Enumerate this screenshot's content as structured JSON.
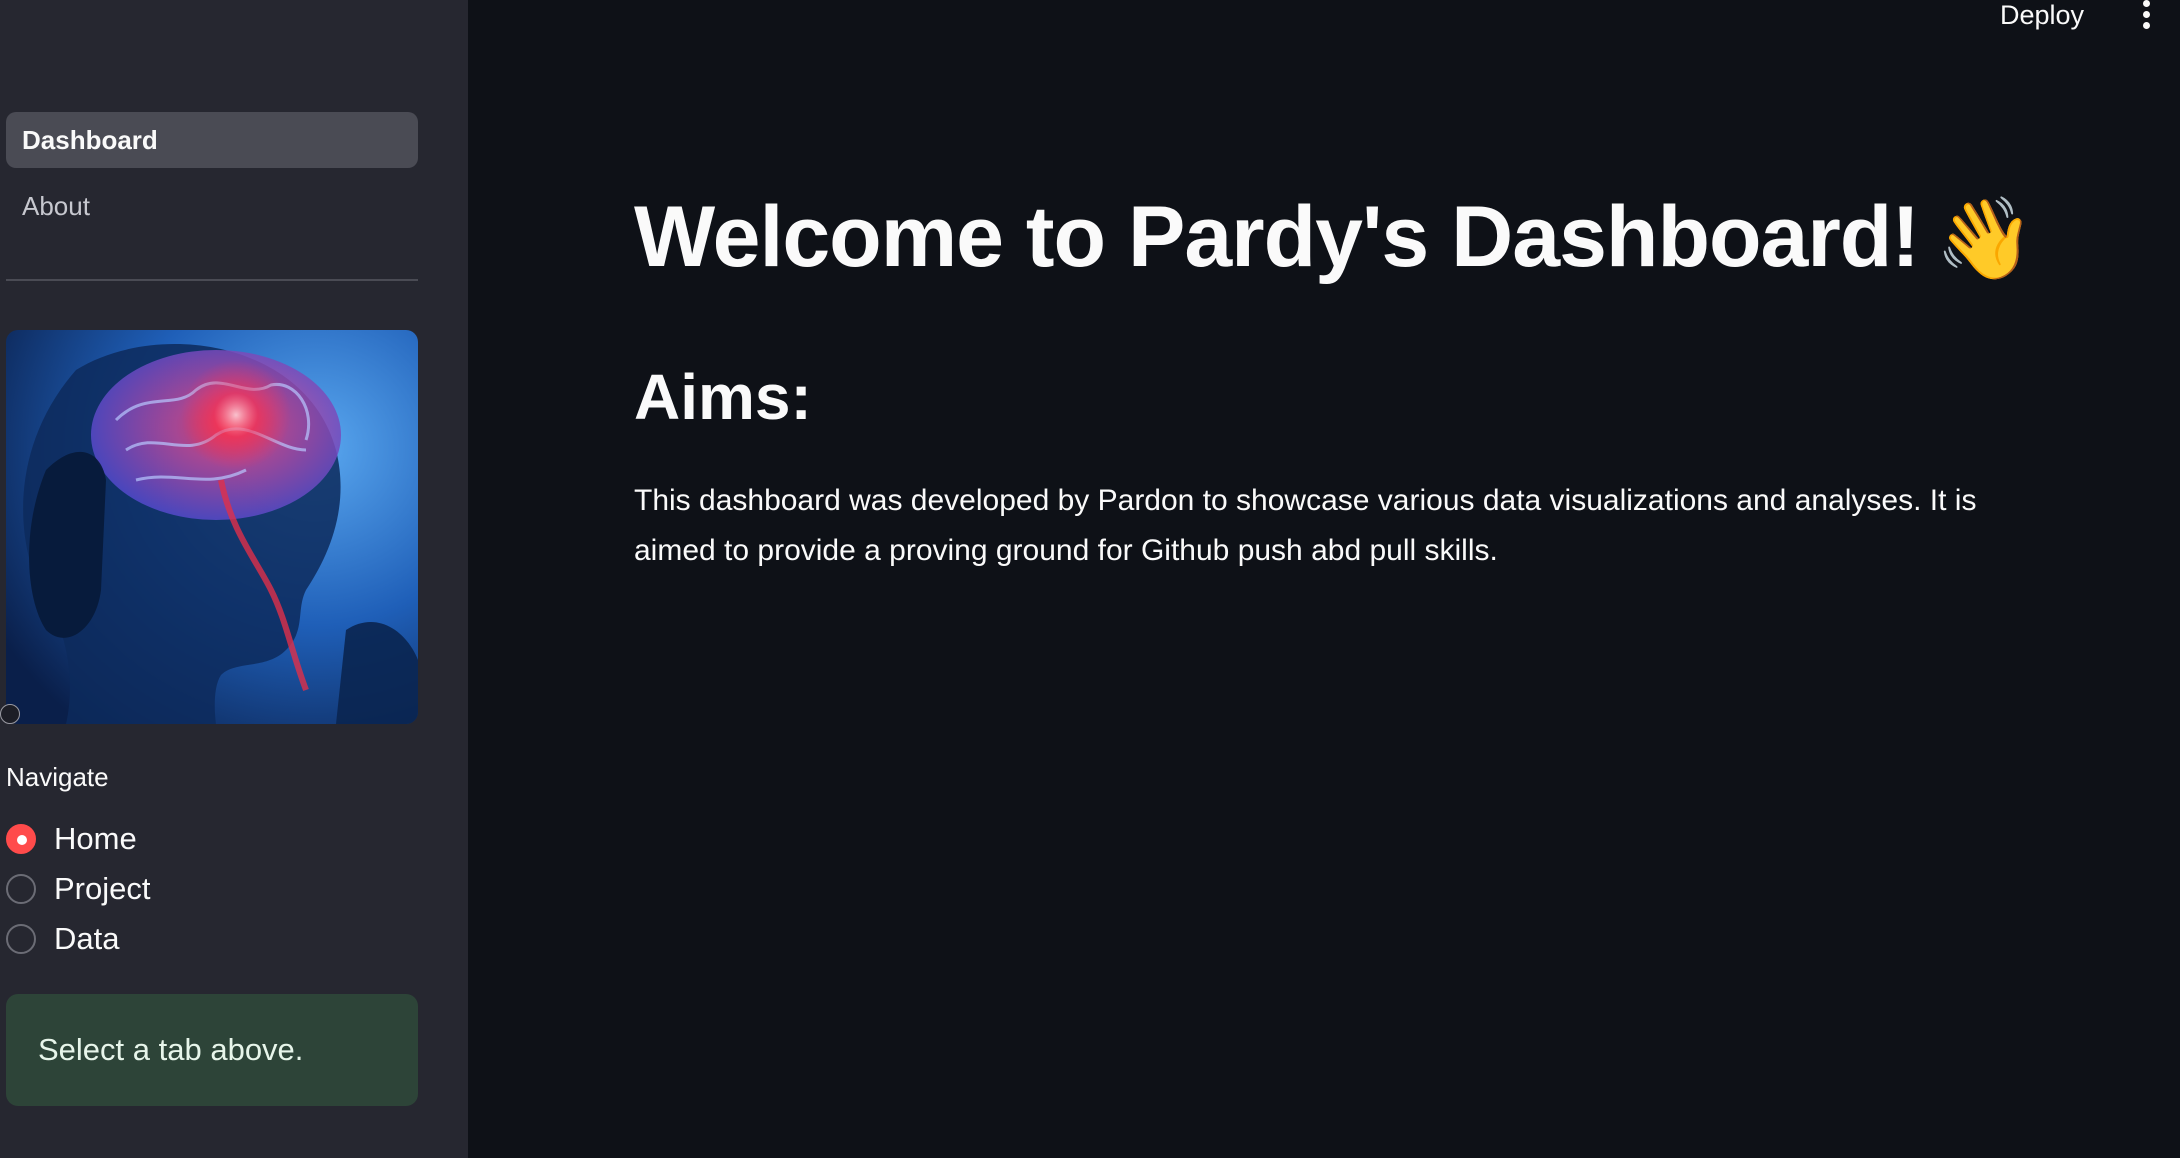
{
  "sidebar": {
    "nav_items": [
      {
        "label": "Dashboard",
        "active": true
      },
      {
        "label": "About",
        "active": false
      }
    ],
    "image_icon": "brain-xray-image",
    "radio": {
      "label": "Navigate",
      "options": [
        {
          "label": "Home",
          "checked": true
        },
        {
          "label": "Project",
          "checked": false
        },
        {
          "label": "Data",
          "checked": false
        }
      ]
    },
    "info_box": "Select a tab above."
  },
  "header": {
    "deploy_label": "Deploy",
    "menu_icon": "more-vertical-icon"
  },
  "main": {
    "title": "Welcome to Pardy's Dashboard!",
    "title_emoji": "👋",
    "aims_heading": "Aims:",
    "description": "This dashboard was developed by Pardon to showcase various data visualizations and analyses. It is aimed to provide a proving ground for Github push abd pull skills."
  },
  "colors": {
    "background": "#0e1117",
    "sidebar": "#262730",
    "accent": "#ff4b4b",
    "info_box": "#2d4438"
  }
}
